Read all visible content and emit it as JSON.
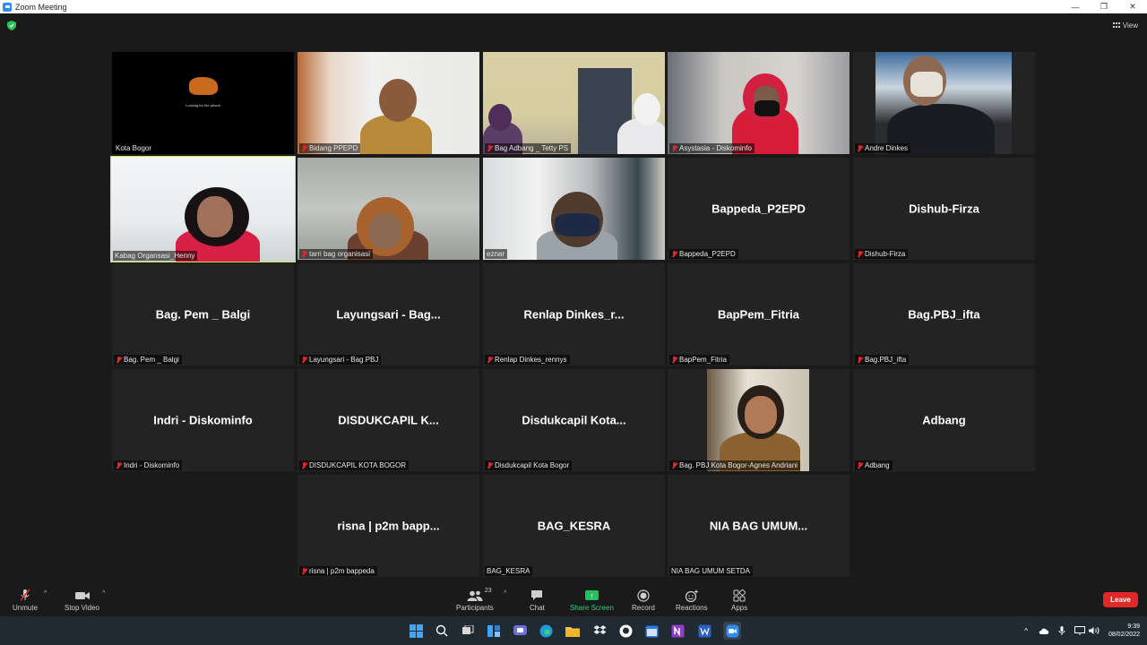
{
  "window": {
    "title": "Zoom Meeting",
    "controls": [
      "—",
      "❐",
      "✕"
    ]
  },
  "view": {
    "label": "View"
  },
  "tiles": [
    {
      "label": "Kota Bogor",
      "caption": "Looking for the phone",
      "muted": false
    },
    {
      "label": "Bidang PPEPD",
      "muted": true
    },
    {
      "label": "Bag Adbang _ Tetty PS",
      "muted": true
    },
    {
      "label": "Asystasia - Diskominfo",
      "muted": true
    },
    {
      "label": "Andre Dinkes",
      "muted": true
    },
    {
      "label": "Kabag Organsasi_Henny",
      "muted": false,
      "active": true
    },
    {
      "label": "tarri bag organisasi",
      "muted": true
    },
    {
      "label": "eznar",
      "muted": false
    },
    {
      "name": "Bappeda_P2EPD",
      "label": "Bappeda_P2EPD",
      "muted": true
    },
    {
      "name": "Dishub-Firza",
      "label": "Dishub-Firza",
      "muted": true
    },
    {
      "name": "Bag. Pem _ Balgi",
      "label": "Bag. Pem _ Balgi",
      "muted": true
    },
    {
      "name": "Layungsari - Bag...",
      "label": "Layungsari - Bag PBJ",
      "muted": true
    },
    {
      "name": "Renlap Dinkes_r...",
      "label": "Renlap Dinkes_rennys",
      "muted": true
    },
    {
      "name": "BapPem_Fitria",
      "label": "BapPem_Fitria",
      "muted": true
    },
    {
      "name": "Bag.PBJ_ifta",
      "label": "Bag.PBJ_ifta",
      "muted": true
    },
    {
      "name": "Indri - Diskominfo",
      "label": "Indri - Diskominfo",
      "muted": true
    },
    {
      "name": "DISDUKCAPIL K...",
      "label": "DISDUKCAPIL KOTA BOGOR",
      "muted": true
    },
    {
      "name": "Disdukcapil Kota...",
      "label": "Disdukcapil Kota Bogor",
      "muted": true
    },
    {
      "label": "Bag. PBJ Kota Bogor-Agnes Andriani",
      "muted": true
    },
    {
      "name": "Adbang",
      "label": "Adbang",
      "muted": true
    },
    {
      "name": "risna | p2m bapp...",
      "label": "risna | p2m bappeda",
      "muted": true
    },
    {
      "name": "BAG_KESRA",
      "label": "BAG_KESRA",
      "muted": false
    },
    {
      "name": "NIA BAG UMUM...",
      "label": "NIA BAG UMUM SETDA",
      "muted": false
    }
  ],
  "toolbar": {
    "unmute": "Unmute",
    "stop_video": "Stop Video",
    "participants": "Participants",
    "participants_count": "23",
    "chat": "Chat",
    "share_screen": "Share Screen",
    "record": "Record",
    "reactions": "Reactions",
    "apps": "Apps",
    "leave": "Leave"
  },
  "taskbar": {
    "time": "9:39",
    "date": "08/02/2022"
  },
  "colors": {
    "active_speaker": "#c6e548",
    "share_green": "#22c05f",
    "leave_red": "#e02828",
    "muted_red": "#e02828"
  }
}
